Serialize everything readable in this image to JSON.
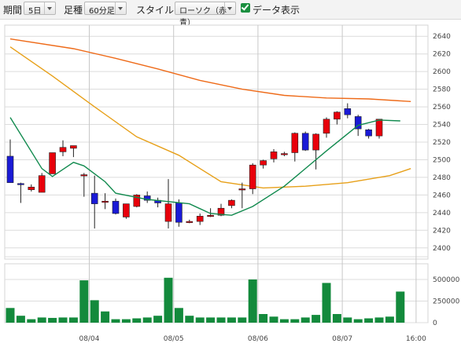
{
  "toolbar": {
    "period_label": "期間",
    "period_value": "5日",
    "bar_label": "足種",
    "bar_value": "60分足",
    "style_label": "スタイル",
    "style_value": "ローソク（赤青）",
    "data_display_label": "データ表示",
    "data_display_checked": true
  },
  "chart_data": {
    "type": "candlestick",
    "y_ticks": [
      "2640",
      "2620",
      "2600",
      "2580",
      "2560",
      "2540",
      "2520",
      "2500",
      "2480",
      "2460",
      "2440",
      "2420",
      "2400"
    ],
    "ylim": [
      2390,
      2650
    ],
    "volume_ticks": [
      "500000",
      "250000",
      "0"
    ],
    "volume_lim": [
      0,
      600000
    ],
    "x_ticks": [
      "08/04",
      "08/05",
      "08/06",
      "08/07",
      "16:00"
    ],
    "x_tick_index": [
      7.5,
      15.5,
      23.5,
      31.5,
      38.5
    ],
    "colors": {
      "up": "#e8000b",
      "down": "#1a1ad6",
      "volume": "#138a3c",
      "ma_short": "#118a4e",
      "ma_mid": "#e7a019",
      "ma_long": "#ee6a18"
    },
    "candles": [
      {
        "o": 2504,
        "h": 2523,
        "l": 2474,
        "c": 2474
      },
      {
        "o": 2473,
        "h": 2474,
        "l": 2451,
        "c": 2472
      },
      {
        "o": 2466,
        "h": 2472,
        "l": 2464,
        "c": 2469
      },
      {
        "o": 2463,
        "h": 2485,
        "l": 2463,
        "c": 2482
      },
      {
        "o": 2484,
        "h": 2508,
        "l": 2484,
        "c": 2508
      },
      {
        "o": 2509,
        "h": 2522,
        "l": 2504,
        "c": 2514
      },
      {
        "o": 2513,
        "h": 2516,
        "l": 2503,
        "c": 2516
      },
      {
        "o": 2483,
        "h": 2485,
        "l": 2458,
        "c": 2483
      },
      {
        "o": 2462,
        "h": 2482,
        "l": 2422,
        "c": 2450
      },
      {
        "o": 2453,
        "h": 2462,
        "l": 2444,
        "c": 2453
      },
      {
        "o": 2453,
        "h": 2456,
        "l": 2438,
        "c": 2439
      },
      {
        "o": 2435,
        "h": 2450,
        "l": 2433,
        "c": 2450
      },
      {
        "o": 2447,
        "h": 2461,
        "l": 2446,
        "c": 2460
      },
      {
        "o": 2459,
        "h": 2464,
        "l": 2451,
        "c": 2454
      },
      {
        "o": 2454,
        "h": 2457,
        "l": 2446,
        "c": 2451
      },
      {
        "o": 2430,
        "h": 2478,
        "l": 2422,
        "c": 2450
      },
      {
        "o": 2451,
        "h": 2455,
        "l": 2424,
        "c": 2429
      },
      {
        "o": 2430,
        "h": 2432,
        "l": 2428,
        "c": 2430
      },
      {
        "o": 2430,
        "h": 2439,
        "l": 2426,
        "c": 2436
      },
      {
        "o": 2437,
        "h": 2445,
        "l": 2435,
        "c": 2437
      },
      {
        "o": 2437,
        "h": 2450,
        "l": 2436,
        "c": 2445
      },
      {
        "o": 2448,
        "h": 2455,
        "l": 2445,
        "c": 2454
      },
      {
        "o": 2466,
        "h": 2474,
        "l": 2445,
        "c": 2467
      },
      {
        "o": 2467,
        "h": 2496,
        "l": 2461,
        "c": 2494
      },
      {
        "o": 2494,
        "h": 2500,
        "l": 2490,
        "c": 2499
      },
      {
        "o": 2501,
        "h": 2512,
        "l": 2497,
        "c": 2509
      },
      {
        "o": 2506,
        "h": 2509,
        "l": 2504,
        "c": 2507
      },
      {
        "o": 2508,
        "h": 2531,
        "l": 2498,
        "c": 2530
      },
      {
        "o": 2530,
        "h": 2532,
        "l": 2510,
        "c": 2511
      },
      {
        "o": 2511,
        "h": 2530,
        "l": 2489,
        "c": 2529
      },
      {
        "o": 2530,
        "h": 2548,
        "l": 2525,
        "c": 2546
      },
      {
        "o": 2546,
        "h": 2555,
        "l": 2540,
        "c": 2554
      },
      {
        "o": 2558,
        "h": 2564,
        "l": 2547,
        "c": 2551
      },
      {
        "o": 2549,
        "h": 2551,
        "l": 2527,
        "c": 2535
      },
      {
        "o": 2534,
        "h": 2535,
        "l": 2524,
        "c": 2527
      },
      {
        "o": 2527,
        "h": 2546,
        "l": 2524,
        "c": 2546
      }
    ],
    "volume": [
      170000,
      80000,
      40000,
      60000,
      55000,
      60000,
      60000,
      490000,
      260000,
      130000,
      40000,
      40000,
      50000,
      60000,
      80000,
      520000,
      170000,
      80000,
      60000,
      60000,
      60000,
      60000,
      60000,
      500000,
      100000,
      70000,
      40000,
      40000,
      60000,
      90000,
      460000,
      100000,
      60000,
      40000,
      50000,
      60000,
      70000,
      360000
    ],
    "ma_short": [
      {
        "i": 0,
        "v": 2548
      },
      {
        "i": 3,
        "v": 2490
      },
      {
        "i": 4,
        "v": 2481
      },
      {
        "i": 6,
        "v": 2497
      },
      {
        "i": 7,
        "v": 2493
      },
      {
        "i": 9,
        "v": 2475
      },
      {
        "i": 10,
        "v": 2462
      },
      {
        "i": 13,
        "v": 2455
      },
      {
        "i": 17,
        "v": 2450
      },
      {
        "i": 19,
        "v": 2439
      },
      {
        "i": 21,
        "v": 2437
      },
      {
        "i": 23,
        "v": 2447
      },
      {
        "i": 26,
        "v": 2470
      },
      {
        "i": 30,
        "v": 2510
      },
      {
        "i": 33,
        "v": 2539
      },
      {
        "i": 35,
        "v": 2545
      },
      {
        "i": 37,
        "v": 2544
      }
    ],
    "ma_mid": [
      {
        "i": 0,
        "v": 2628
      },
      {
        "i": 4,
        "v": 2595
      },
      {
        "i": 8,
        "v": 2560
      },
      {
        "i": 12,
        "v": 2526
      },
      {
        "i": 16,
        "v": 2505
      },
      {
        "i": 20,
        "v": 2475
      },
      {
        "i": 24,
        "v": 2468
      },
      {
        "i": 28,
        "v": 2470
      },
      {
        "i": 32,
        "v": 2474
      },
      {
        "i": 36,
        "v": 2482
      },
      {
        "i": 38,
        "v": 2490
      }
    ],
    "ma_long": [
      {
        "i": 0,
        "v": 2637
      },
      {
        "i": 6,
        "v": 2626
      },
      {
        "i": 10,
        "v": 2615
      },
      {
        "i": 14,
        "v": 2603
      },
      {
        "i": 18,
        "v": 2590
      },
      {
        "i": 22,
        "v": 2580
      },
      {
        "i": 26,
        "v": 2573
      },
      {
        "i": 30,
        "v": 2570
      },
      {
        "i": 34,
        "v": 2569
      },
      {
        "i": 38,
        "v": 2566
      }
    ]
  }
}
